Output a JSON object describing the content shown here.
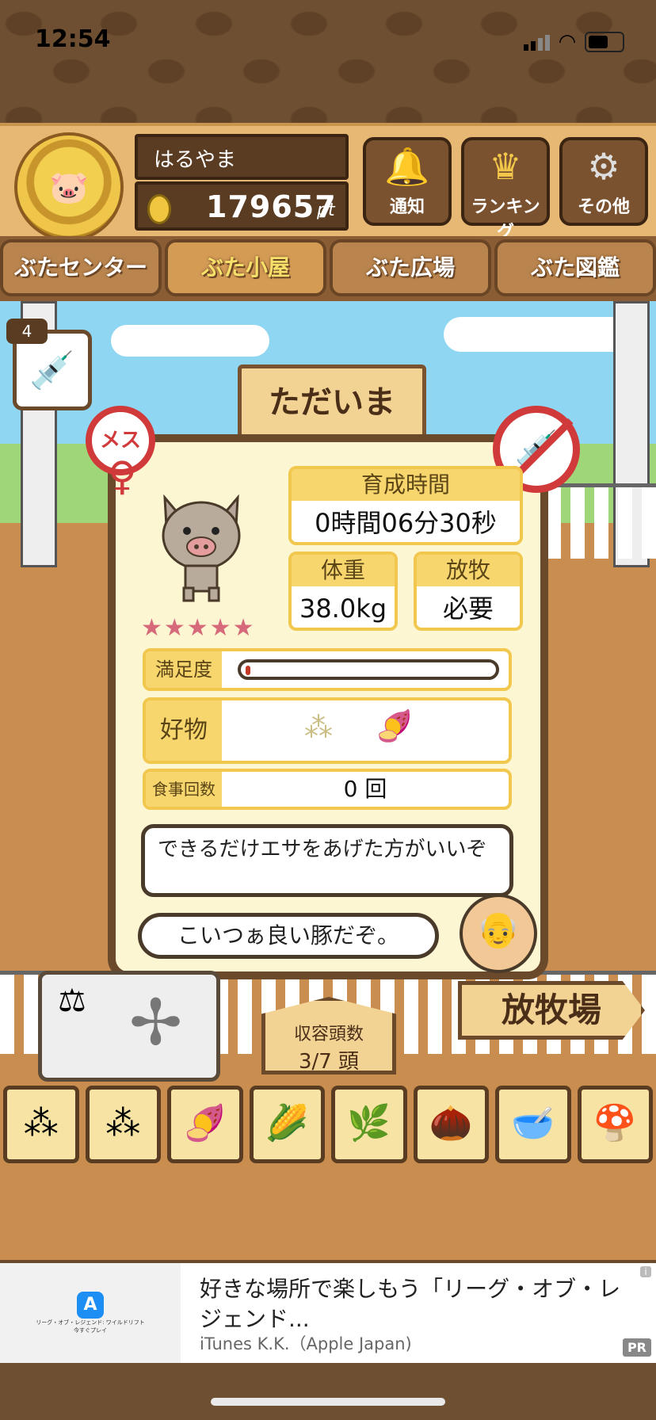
{
  "status_bar": {
    "time": "12:54"
  },
  "header": {
    "player_name": "はるやま",
    "points": "179657",
    "points_unit": "pt",
    "buttons": [
      {
        "label": "通知",
        "icon": "bell-icon"
      },
      {
        "label": "ランキング",
        "icon": "crown-icon"
      },
      {
        "label": "その他",
        "icon": "gear-icon"
      }
    ]
  },
  "nav": {
    "tabs": [
      {
        "label": "ぶたセンター",
        "active": false
      },
      {
        "label": "ぶた小屋",
        "active": true
      },
      {
        "label": "ぶた広場",
        "active": false
      },
      {
        "label": "ぶた図鑑",
        "active": false
      }
    ]
  },
  "scene": {
    "syringe_count": "4",
    "welcome_sign": "ただいま"
  },
  "pig_card": {
    "gender_badge": "メス",
    "growth_time_label": "育成時間",
    "growth_time_value": "0時間06分30秒",
    "weight_label": "体重",
    "weight_value": "38.0kg",
    "grazing_label": "放牧",
    "grazing_value": "必要",
    "stars": "★★★★★",
    "satisfaction_label": "満足度",
    "satisfaction_level": 0.02,
    "favorite_label": "好物",
    "meals_label": "食事回数",
    "meals_value": "0 回",
    "advice": "できるだけエサをあげた方がいいぞ",
    "comment": "こいつぁ良い豚だぞ。"
  },
  "bottom": {
    "capacity_label": "収容頭数",
    "capacity_value": "3/7 頭",
    "ranch_sign": "放牧場",
    "food_items": [
      "soybean-pile-icon",
      "grain-pile-icon",
      "sweet-potato-icon",
      "corn-icon",
      "herb-icon",
      "acorn-icon",
      "beans-bowl-icon",
      "truffle-plate-icon"
    ]
  },
  "ad": {
    "title": "好きな場所で楽しもう「リーグ・オブ・レジェンド...",
    "source": "iTunes K.K.（Apple Japan)",
    "badge": "PR",
    "icon_caption": "リーグ・オブ・レジェンド: ワイルドリフト",
    "icon_caption2": "今すぐプレイ"
  }
}
